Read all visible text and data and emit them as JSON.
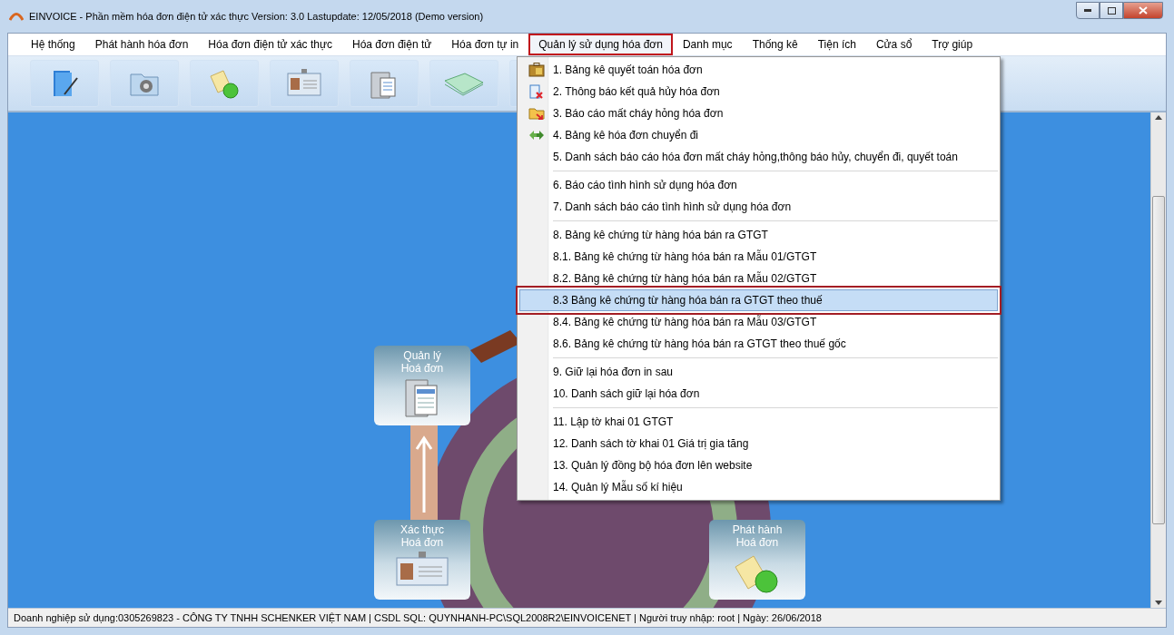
{
  "window": {
    "title": "EINVOICE - Phần mềm hóa đơn điện tử xác thực Version: 3.0 Lastupdate: 12/05/2018 (Demo version)"
  },
  "menu_bar": [
    {
      "label": "Hệ thống",
      "selected": false
    },
    {
      "label": "Phát hành hóa đơn",
      "selected": false
    },
    {
      "label": "Hóa đơn điện tử xác thực",
      "selected": false
    },
    {
      "label": "Hóa đơn điện tử",
      "selected": false
    },
    {
      "label": "Hóa đơn tự in",
      "selected": false
    },
    {
      "label": "Quản lý sử dụng hóa đơn",
      "selected": true
    },
    {
      "label": "Danh mục",
      "selected": false
    },
    {
      "label": "Thống kê",
      "selected": false
    },
    {
      "label": "Tiện ích",
      "selected": false
    },
    {
      "label": "Cửa sổ",
      "selected": false
    },
    {
      "label": "Trợ giúp",
      "selected": false
    }
  ],
  "dropdown": {
    "groups": [
      {
        "items": [
          {
            "label": "1. Bảng kê quyết toán hóa đơn",
            "selected": false,
            "kind": "briefcase"
          },
          {
            "label": "2. Thông báo kết quả hủy hóa đơn",
            "selected": false,
            "kind": "cancel"
          },
          {
            "label": "3. Báo cáo mất cháy hỏng hóa đơn",
            "selected": false,
            "kind": "folder"
          },
          {
            "label": "4. Bảng kê hóa đơn chuyển đi",
            "selected": false,
            "kind": "arrows"
          },
          {
            "label": "5. Danh sách báo cáo hóa đơn mất cháy hỏng,thông báo hủy, chuyển đi, quyết toán",
            "selected": false,
            "kind": "plain"
          }
        ]
      },
      {
        "items": [
          {
            "label": "6. Báo cáo tình hình sử dụng hóa đơn",
            "selected": false,
            "kind": "plain"
          },
          {
            "label": "7. Danh sách báo cáo tình hình sử dụng hóa đơn",
            "selected": false,
            "kind": "plain"
          }
        ]
      },
      {
        "items": [
          {
            "label": "8. Bảng kê chứng từ hàng hóa bán ra GTGT",
            "selected": false,
            "kind": "plain"
          },
          {
            "label": "8.1. Bảng kê chứng từ hàng hóa bán ra Mẫu 01/GTGT",
            "selected": false,
            "kind": "plain"
          },
          {
            "label": "8.2. Bảng kê chứng từ hàng hóa bán ra Mẫu 02/GTGT",
            "selected": false,
            "kind": "plain"
          },
          {
            "label": "8.3 Bảng kê chứng từ hàng hóa bán ra GTGT theo thuế",
            "selected": true,
            "kind": "plain"
          },
          {
            "label": "8.4. Bảng kê chứng từ hàng hóa bán ra Mẫu 03/GTGT",
            "selected": false,
            "kind": "plain"
          },
          {
            "label": "8.6. Bảng kê chứng từ hàng hóa bán ra GTGT theo thuế  gốc",
            "selected": false,
            "kind": "plain"
          }
        ]
      },
      {
        "items": [
          {
            "label": "9. Giữ lại hóa đơn in sau",
            "selected": false,
            "kind": "plain"
          },
          {
            "label": "10. Danh sách giữ lại hóa đơn",
            "selected": false,
            "kind": "plain"
          }
        ]
      },
      {
        "items": [
          {
            "label": "11. Lập tờ khai 01 GTGT",
            "selected": false,
            "kind": "plain"
          },
          {
            "label": "12. Danh sách tờ khai 01 Giá trị gia tăng",
            "selected": false,
            "kind": "plain"
          },
          {
            "label": "13. Quản lý đồng bộ hóa đơn lên website",
            "selected": false,
            "kind": "plain"
          },
          {
            "label": "14. Quản lý Mẫu số kí hiệu",
            "selected": false,
            "kind": "plain"
          }
        ]
      }
    ]
  },
  "workflow_tiles": [
    {
      "label": "Quản lý Hoá đơn",
      "kind": "folder"
    },
    {
      "label": "Xác thực Hoá đơn",
      "kind": "card"
    },
    {
      "label": "Phát hành Hoá đơn",
      "kind": "papers"
    }
  ],
  "status_bar": {
    "text": "Doanh nghiệp sử dụng:0305269823 - CÔNG TY TNHH SCHENKER VIỆT NAM | CSDL SQL: QUYNHANH-PC\\SQL2008R2\\EINVOICENET | Người truy nhập: root | Ngày: 26/06/2018"
  }
}
